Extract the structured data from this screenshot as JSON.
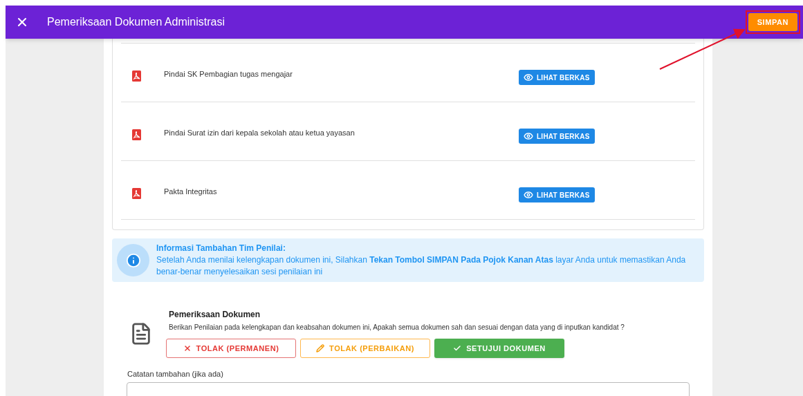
{
  "header": {
    "title": "Pemeriksaan Dokumen Administrasi",
    "save_button": {
      "label": "SIMPAN",
      "highlighted": true
    }
  },
  "documents": [
    {
      "name": "Pindai SK Pembagian tugas mengajar",
      "action": "LIHAT BERKAS"
    },
    {
      "name": "Pindai Surat izin dari kepala sekolah atau ketua yayasan",
      "action": "LIHAT BERKAS"
    },
    {
      "name": "Pakta Integritas",
      "action": "LIHAT BERKAS"
    }
  ],
  "info": {
    "title": "Informasi Tambahan Tim Penilai:",
    "text": "Setelah Anda menilai kelengkapan dokumen ini, Silahkan **Tekan Tombol SIMPAN Pada Pojok Kanan Atas** layar Anda untuk memastikan Anda benar-benar menyelesaikan sesi penilaian ini"
  },
  "review": {
    "title": "Pemeriksaan Dokumen",
    "description": "Berikan Penilaian pada kelengkapan dan keabsahan dokumen ini, Apakah semua dokumen sah dan sesuai dengan data yang di inputkan kandidat ?",
    "decisions": [
      {
        "kind": "reject",
        "label": "TOLAK (PERMANEN)"
      },
      {
        "kind": "revise",
        "label": "TOLAK (PERBAIKAN)"
      },
      {
        "kind": "approve",
        "label": "SETUJUI DOKUMEN"
      }
    ],
    "notes": {
      "label": "Catatan tambahan (jika ada)"
    }
  }
}
